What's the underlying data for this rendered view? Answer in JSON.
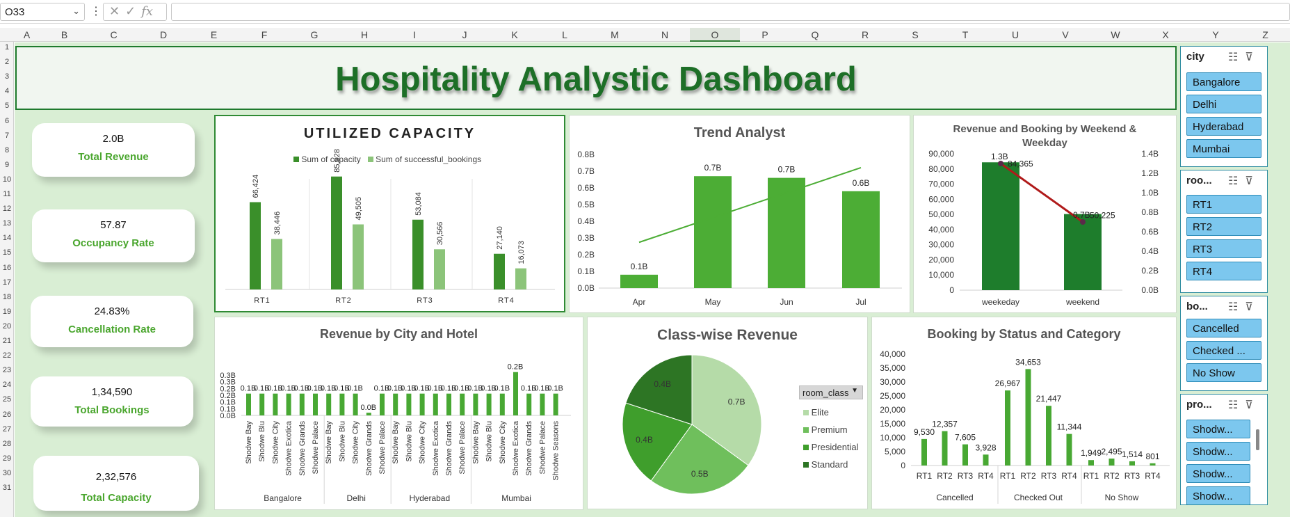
{
  "formula_bar": {
    "name_box": "O33",
    "fx": "fx",
    "formula": ""
  },
  "columns": [
    "A",
    "B",
    "C",
    "D",
    "E",
    "F",
    "G",
    "H",
    "I",
    "J",
    "K",
    "L",
    "M",
    "N",
    "O",
    "P",
    "Q",
    "R",
    "S",
    "T",
    "U",
    "V",
    "W",
    "X",
    "Y",
    "Z"
  ],
  "selected_column": "O",
  "rows": [
    "1",
    "2",
    "3",
    "4",
    "5",
    "6",
    "7",
    "8",
    "9",
    "10",
    "11",
    "12",
    "13",
    "14",
    "15",
    "16",
    "17",
    "18",
    "19",
    "20",
    "21",
    "22",
    "23",
    "24",
    "25",
    "26",
    "27",
    "28",
    "29",
    "30",
    "31"
  ],
  "dashboard_title": "Hospitality Analystic Dashboard",
  "kpis": [
    {
      "value": "2.0B",
      "label": "Total Revenue"
    },
    {
      "value": "57.87",
      "label": "Occupancy Rate"
    },
    {
      "value": "24.83%",
      "label": "Cancellation Rate"
    },
    {
      "value": "1,34,590",
      "label": "Total Bookings"
    },
    {
      "value": "2,32,576",
      "label": "Total Capacity"
    }
  ],
  "colors": {
    "dark_green": "#3a8f2a",
    "light_green": "#8cc47a",
    "bar_green": "#48a833",
    "slicer_btn": "#7cc7ee",
    "line_red": "#b01a1a"
  },
  "chart_data": [
    {
      "type": "bar",
      "title": "UTILIZED CAPACITY",
      "categories": [
        "RT1",
        "RT2",
        "RT3",
        "RT4"
      ],
      "series": [
        {
          "name": "Sum of capacity",
          "values": [
            66424,
            85928,
            53084,
            27140
          ],
          "labels": [
            "66,424",
            "85,928",
            "53,084",
            "27,140"
          ]
        },
        {
          "name": "Sum of successful_bookings",
          "values": [
            38446,
            49505,
            30566,
            16073
          ],
          "labels": [
            "38,446",
            "49,505",
            "30,566",
            "16,073"
          ]
        }
      ],
      "legend": "top",
      "ylim": [
        0,
        90000
      ]
    },
    {
      "type": "bar",
      "title": "Trend Analyst",
      "categories": [
        "Apr",
        "May",
        "Jun",
        "Jul"
      ],
      "values": [
        0.08,
        0.67,
        0.66,
        0.58
      ],
      "labels": [
        "0.1B",
        "0.7B",
        "0.7B",
        "0.6B"
      ],
      "yticks": [
        "0.0B",
        "0.1B",
        "0.2B",
        "0.3B",
        "0.4B",
        "0.5B",
        "0.6B",
        "0.7B",
        "0.8B"
      ],
      "ylim": [
        0,
        0.8
      ],
      "trendline": true
    },
    {
      "type": "bar",
      "title": "Revenue and Booking by Weekend & Weekday",
      "categories": [
        "weekeday",
        "weekend"
      ],
      "series": [
        {
          "name": "bookings",
          "values": [
            84365,
            50225
          ],
          "labels": [
            "84,365",
            "50,225"
          ]
        },
        {
          "name": "revenue",
          "values": [
            1.3,
            0.7
          ],
          "labels": [
            "1.3B",
            "0.7B"
          ]
        }
      ],
      "yticks": [
        "0",
        "10,000",
        "20,000",
        "30,000",
        "40,000",
        "50,000",
        "60,000",
        "70,000",
        "80,000",
        "90,000"
      ],
      "y2ticks": [
        "0.0B",
        "0.2B",
        "0.4B",
        "0.6B",
        "0.8B",
        "1.0B",
        "1.2B",
        "1.4B"
      ],
      "ylim": [
        0,
        90000
      ],
      "y2lim": [
        0,
        1.4
      ]
    },
    {
      "type": "bar",
      "title": "Revenue by City and Hotel",
      "groups": [
        {
          "city": "Bangalore",
          "hotels": [
            "Shodwe Bay",
            "Shodwe Blu",
            "Shodwe City",
            "Shodwe Exotica",
            "Shodwe Grands",
            "Shodwe Palace"
          ],
          "values": [
            0.1,
            0.1,
            0.1,
            0.1,
            0.1,
            0.1
          ]
        },
        {
          "city": "Delhi",
          "hotels": [
            "Shodwe Bay",
            "Shodwe Blu",
            "Shodwe City",
            "Shodwe Grands",
            "Shodwe Palace"
          ],
          "values": [
            0.1,
            0.1,
            0.1,
            0.0,
            0.1
          ]
        },
        {
          "city": "Hyderabad",
          "hotels": [
            "Shodwe Bay",
            "Shodwe Blu",
            "Shodwe City",
            "Shodwe Exotica",
            "Shodwe Grands",
            "Shodwe Palace"
          ],
          "values": [
            0.1,
            0.1,
            0.1,
            0.1,
            0.1,
            0.1
          ]
        },
        {
          "city": "Mumbai",
          "hotels": [
            "Shodwe Bay",
            "Shodwe Blu",
            "Shodwe City",
            "Shodwe Exotica",
            "Shodwe Grands",
            "Shodwe Palace",
            "Shodwe Seasons"
          ],
          "values": [
            0.1,
            0.1,
            0.1,
            0.2,
            0.1,
            0.1,
            0.1
          ]
        }
      ],
      "labels": [
        "0.1B",
        "0.1B",
        "0.1B",
        "0.1B",
        "0.1B",
        "0.1B",
        "0.1B",
        "0.1B",
        "0.1B",
        "0.0B",
        "0.1B",
        "0.1B",
        "0.1B",
        "0.1B",
        "0.1B",
        "0.1B",
        "0.1B",
        "0.1B",
        "0.1B",
        "0.1B",
        "0.2B",
        "0.1B",
        "0.1B",
        "0.1B"
      ],
      "yticks": [
        "0.0B",
        "0.1B",
        "0.1B",
        "0.2B",
        "0.2B",
        "0.3B",
        "0.3B"
      ],
      "ylim": [
        0,
        0.3
      ]
    },
    {
      "type": "pie",
      "title": "Class-wise Revenue",
      "slices": [
        {
          "name": "Elite",
          "value": 0.7,
          "label": "0.7B"
        },
        {
          "name": "Premium",
          "value": 0.5,
          "label": "0.5B"
        },
        {
          "name": "Presidential",
          "value": 0.4,
          "label": "0.4B"
        },
        {
          "name": "Standard",
          "value": 0.4,
          "label": "0.4B"
        }
      ],
      "legend_title": "room_class",
      "legend": "right"
    },
    {
      "type": "bar",
      "title": "Booking by Status and Category",
      "groups": [
        {
          "status": "Cancelled",
          "categories": [
            "RT1",
            "RT2",
            "RT3",
            "RT4"
          ],
          "values": [
            9530,
            12357,
            7605,
            3928
          ],
          "labels": [
            "9,530",
            "12,357",
            "7,605",
            "3,928"
          ]
        },
        {
          "status": "Checked Out",
          "categories": [
            "RT1",
            "RT2",
            "RT3",
            "RT4"
          ],
          "values": [
            26967,
            34653,
            21447,
            11344
          ],
          "labels": [
            "26,967",
            "34,653",
            "21,447",
            "11,344"
          ]
        },
        {
          "status": "No Show",
          "categories": [
            "RT1",
            "RT2",
            "RT3",
            "RT4"
          ],
          "values": [
            1949,
            2495,
            1514,
            801
          ],
          "labels": [
            "1,949",
            "2,495",
            "1,514",
            "801"
          ]
        }
      ],
      "yticks": [
        "0",
        "5,000",
        "10,000",
        "15,000",
        "20,000",
        "25,000",
        "30,000",
        "35,000",
        "40,000"
      ],
      "ylim": [
        0,
        40000
      ]
    }
  ],
  "slicers": [
    {
      "header": "city",
      "items": [
        "Bangalore",
        "Delhi",
        "Hyderabad",
        "Mumbai"
      ]
    },
    {
      "header": "roo...",
      "items": [
        "RT1",
        "RT2",
        "RT3",
        "RT4"
      ]
    },
    {
      "header": "bo...",
      "items": [
        "Cancelled",
        "Checked ...",
        "No Show"
      ]
    },
    {
      "header": "pro...",
      "items": [
        "Shodw...",
        "Shodw...",
        "Shodw...",
        "Shodw..."
      ]
    }
  ]
}
